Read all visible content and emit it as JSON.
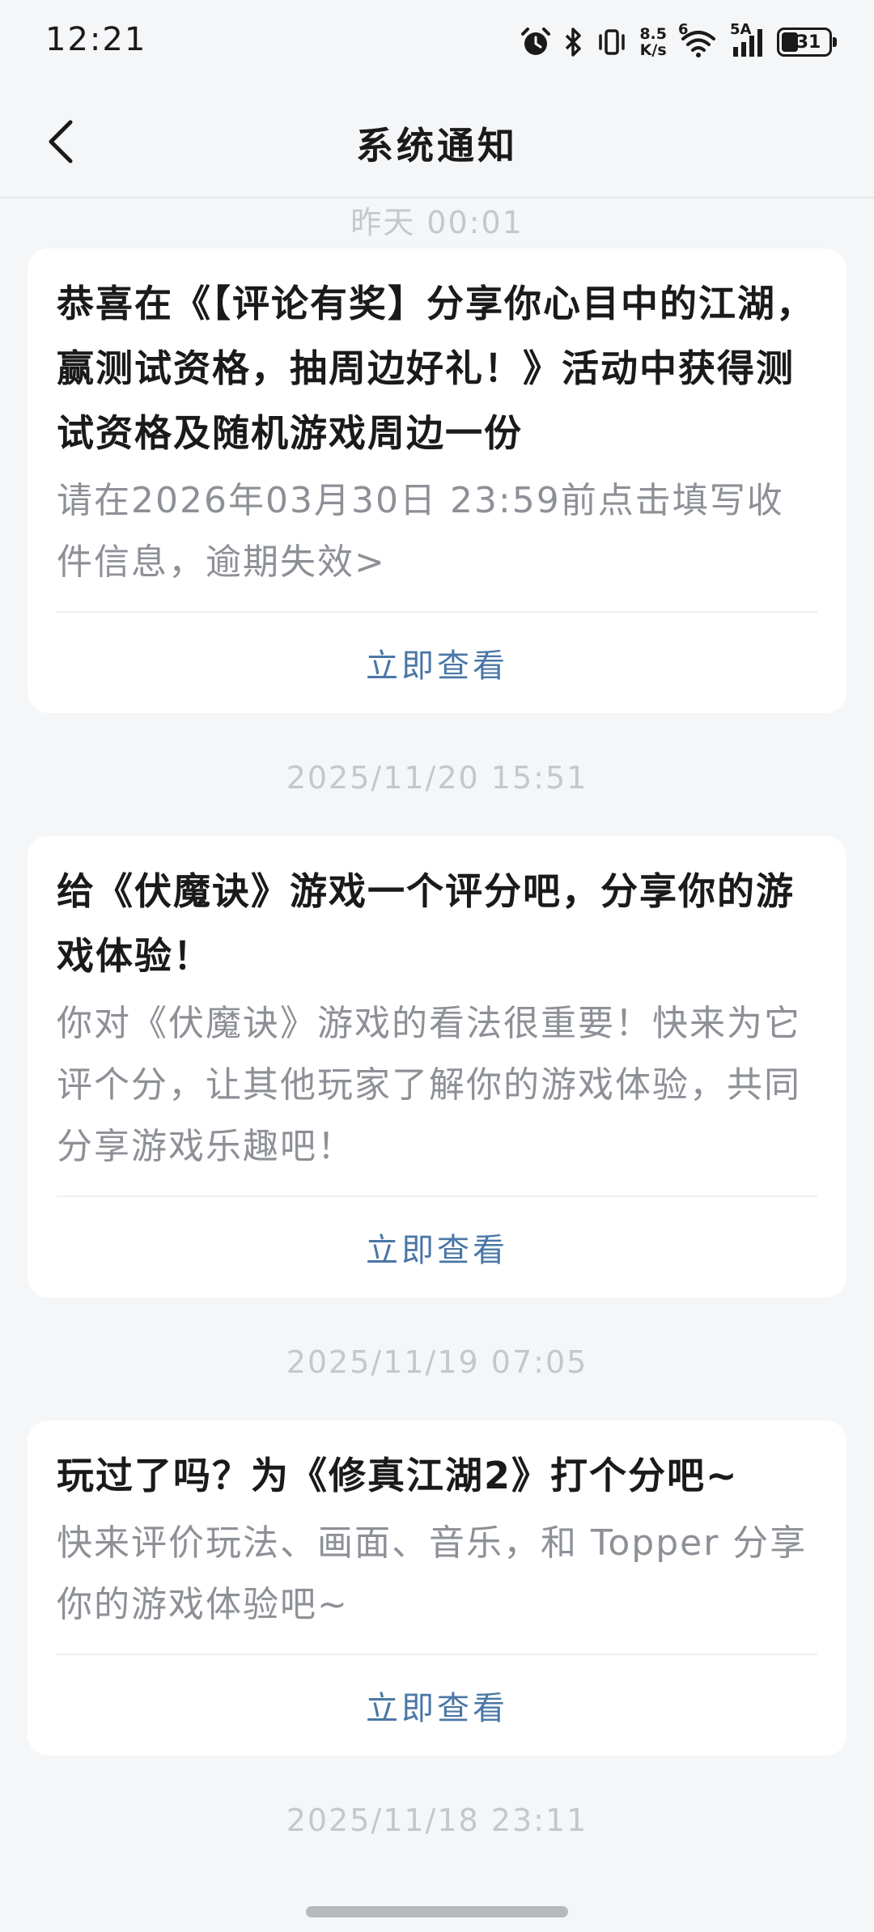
{
  "status_bar": {
    "time": "12:21",
    "net_speed_value": "8.5",
    "net_speed_unit": "K/s",
    "wifi_label": "6",
    "cell_label": "5A",
    "battery": "31"
  },
  "header": {
    "title": "系统通知"
  },
  "notifications": [
    {
      "timestamp": "昨天 00:01",
      "title": "恭喜在《【评论有奖】分享你心目中的江湖，赢测试资格，抽周边好礼！》活动中获得测试资格及随机游戏周边一份",
      "body": "请在2026年03月30日 23:59前点击填写收件信息，逾期失效>",
      "action": "立即查看"
    },
    {
      "timestamp": "2025/11/20  15:51",
      "title": "给《伏魔诀》游戏一个评分吧，分享你的游戏体验！",
      "body": "你对《伏魔诀》游戏的看法很重要！快来为它评个分，让其他玩家了解你的游戏体验，共同分享游戏乐趣吧！",
      "action": "立即查看"
    },
    {
      "timestamp": "2025/11/19  07:05",
      "title": "玩过了吗？为《修真江湖2》打个分吧~",
      "body": "快来评价玩法、画面、音乐，和 Topper 分享你的游戏体验吧~",
      "action": "立即查看"
    }
  ],
  "next_timestamp": "2025/11/18  23:11",
  "icons": {
    "back": "chevron-left-icon",
    "alarm": "alarm-icon",
    "bluetooth": "bluetooth-icon",
    "vibrate": "vibrate-icon",
    "wifi": "wifi-icon",
    "signal": "signal-icon",
    "battery": "battery-icon"
  },
  "colors": {
    "accent": "#4a77a6",
    "background": "#f5f6f8",
    "card": "#ffffff",
    "timestamp": "#c4c7cc",
    "body_text": "#8d9096"
  }
}
